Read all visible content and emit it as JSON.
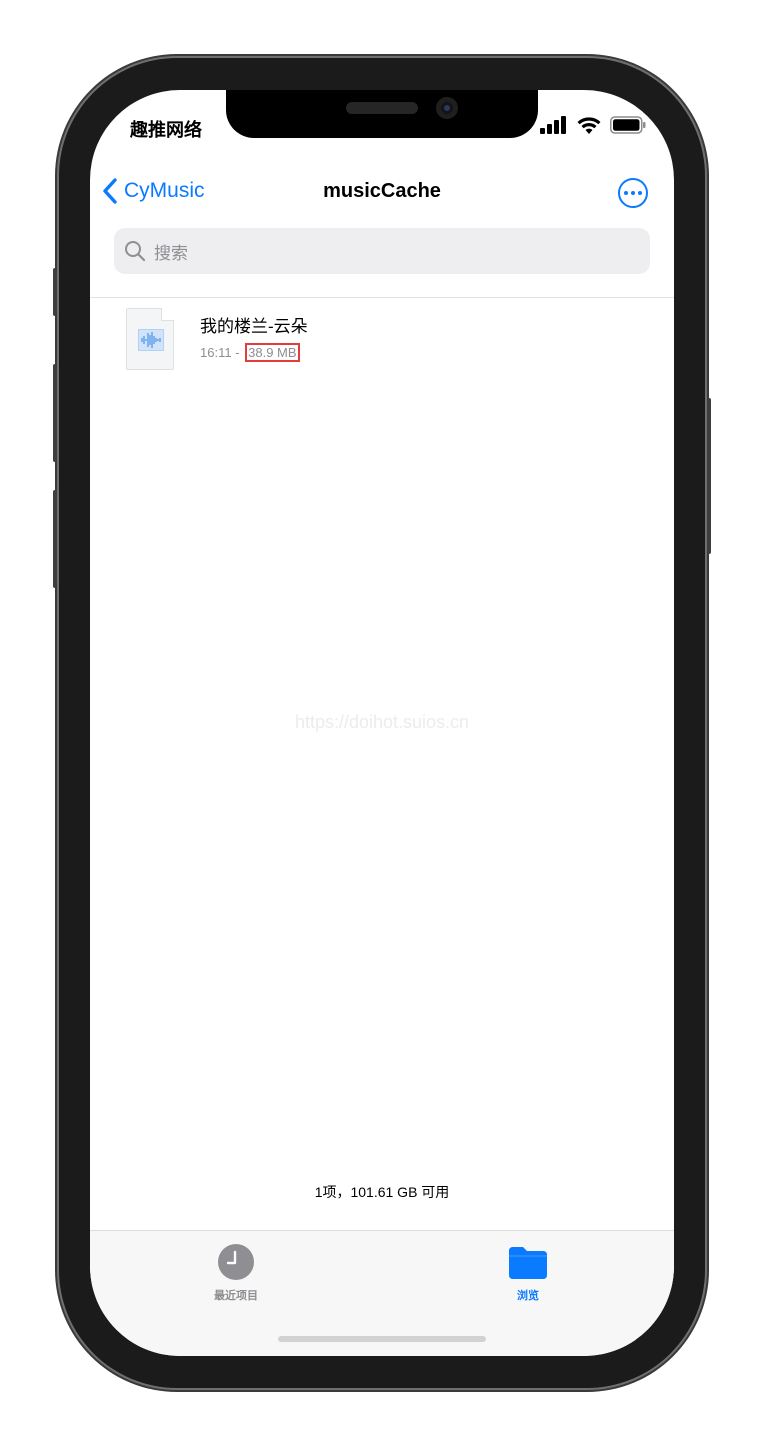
{
  "status_bar": {
    "carrier": "趣推网络",
    "signal_icon": "cellular-signal-icon",
    "wifi_icon": "wifi-icon",
    "battery_icon": "battery-icon"
  },
  "nav": {
    "back_label": "CyMusic",
    "title": "musicCache",
    "more_icon": "ellipsis-circle-icon",
    "accent_color": "#0a7aff"
  },
  "search": {
    "placeholder": "搜索"
  },
  "files": [
    {
      "name": "我的楼兰-云朵",
      "time": "16:11",
      "separator": " - ",
      "size": "38.9 MB",
      "icon": "audio-file-icon"
    }
  ],
  "watermark": "https://doihot.suios.cn",
  "footer": {
    "info": "1项，101.61 GB 可用"
  },
  "tabbar": {
    "tabs": [
      {
        "label": "最近项目",
        "icon": "clock-icon",
        "active": false
      },
      {
        "label": "浏览",
        "icon": "folder-icon",
        "active": true
      }
    ]
  }
}
